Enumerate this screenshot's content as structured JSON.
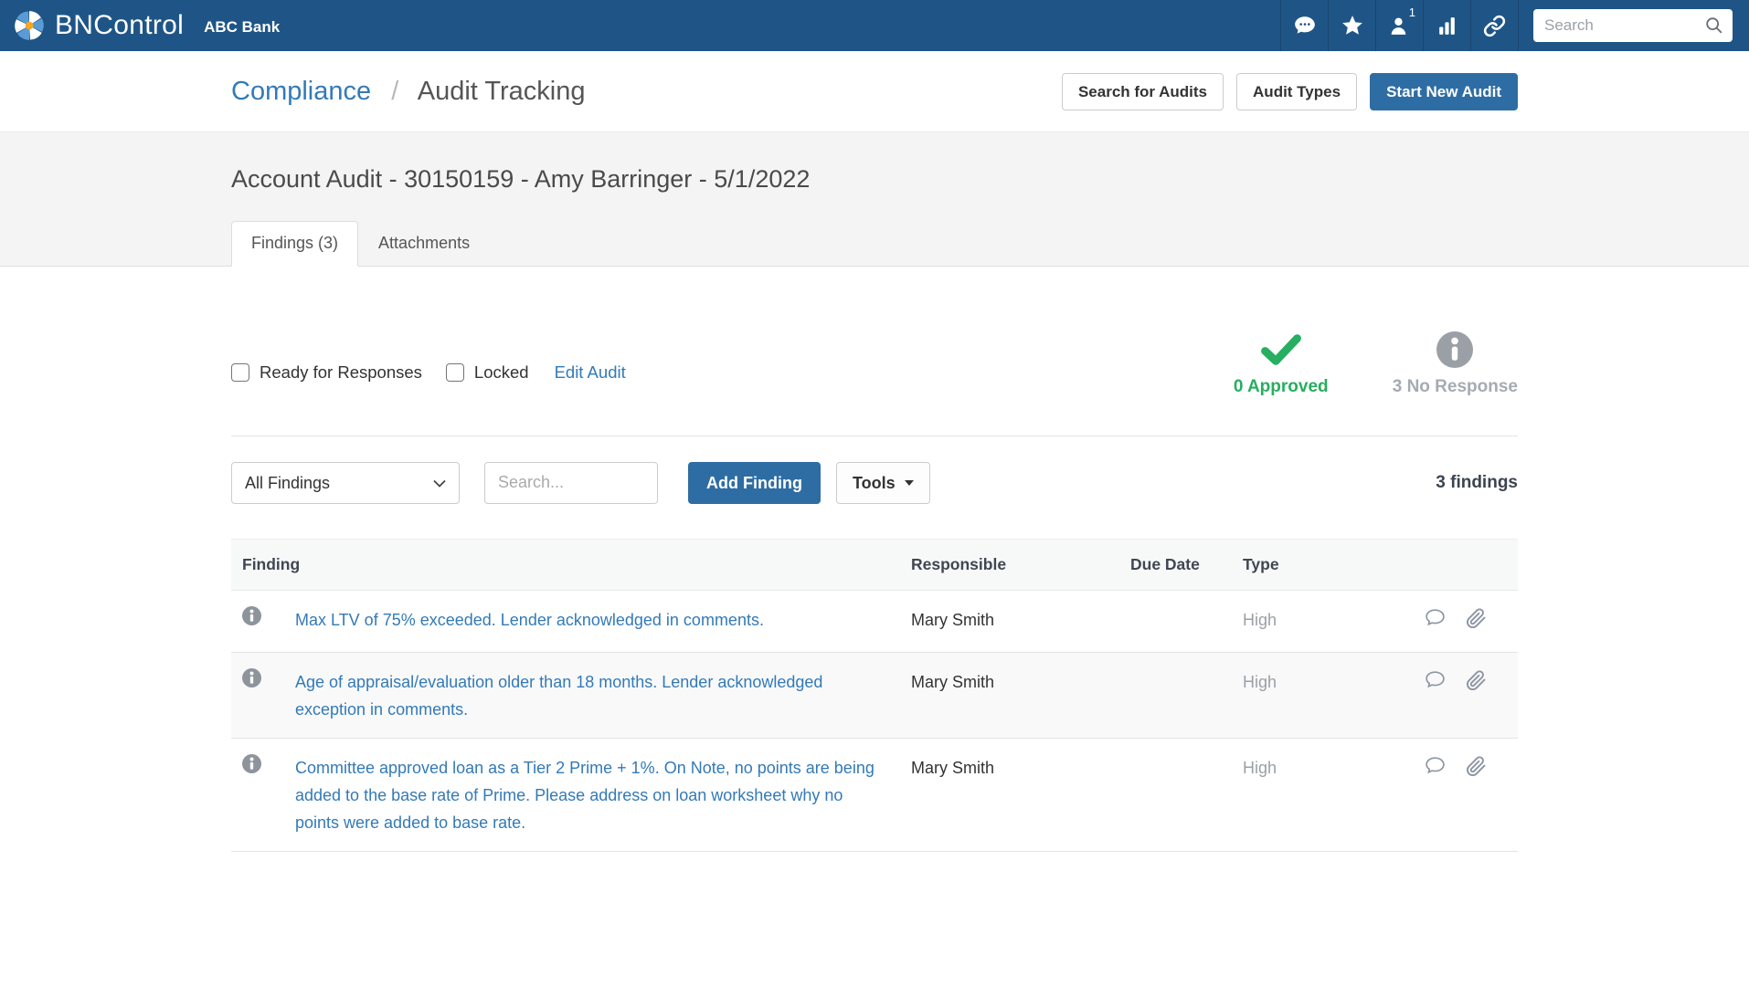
{
  "colors": {
    "navbar_blue": "#1f5586",
    "primary_blue": "#2e6da4",
    "link_blue": "#337ab7",
    "success_green": "#27ae60",
    "muted_gray": "#a5abb3",
    "icon_gray": "#8d949c",
    "logo_orange": "#f5a623",
    "logo_light_blue": "#5b9bd5"
  },
  "navbar": {
    "brand": "BNControl",
    "org": "ABC Bank",
    "badge_count": "1",
    "icons": [
      "messages-icon",
      "favorites-star-icon",
      "users-icon",
      "reports-bar-chart-icon",
      "links-chain-icon",
      "search-icon"
    ],
    "search_placeholder": "Search"
  },
  "breadcrumb": {
    "parent": "Compliance",
    "separator": "/",
    "current": "Audit Tracking"
  },
  "header_actions": {
    "search_for_audits": "Search for Audits",
    "audit_types": "Audit Types",
    "start_new_audit": "Start New Audit"
  },
  "page": {
    "title": "Account Audit - 30150159 - Amy Barringer - 5/1/2022"
  },
  "tabs": [
    {
      "label": "Findings (3)",
      "active": true
    },
    {
      "label": "Attachments",
      "active": false
    }
  ],
  "controls": {
    "ready_for_responses": "Ready for Responses",
    "locked": "Locked",
    "edit_audit": "Edit Audit"
  },
  "status": {
    "approved": {
      "count_label": "0 Approved"
    },
    "no_response": {
      "count_label": "3 No Response"
    }
  },
  "filter_bar": {
    "filter_selected": "All Findings",
    "search_placeholder": "Search...",
    "add_finding": "Add Finding",
    "tools": "Tools",
    "count_label": "3 findings"
  },
  "table": {
    "columns": [
      "Finding",
      "Responsible",
      "Due Date",
      "Type"
    ],
    "rows": [
      {
        "finding": "Max LTV of 75% exceeded. Lender acknowledged in comments.",
        "responsible": "Mary Smith",
        "due_date": "",
        "type": "High"
      },
      {
        "finding": "Age of appraisal/evaluation older than 18 months. Lender acknowledged exception in comments.",
        "responsible": "Mary Smith",
        "due_date": "",
        "type": "High"
      },
      {
        "finding": "Committee approved loan as a Tier 2 Prime + 1%. On Note, no points are being added to the base rate of Prime. Please address on loan worksheet why no points were added to base rate.",
        "responsible": "Mary Smith",
        "due_date": "",
        "type": "High"
      }
    ]
  }
}
